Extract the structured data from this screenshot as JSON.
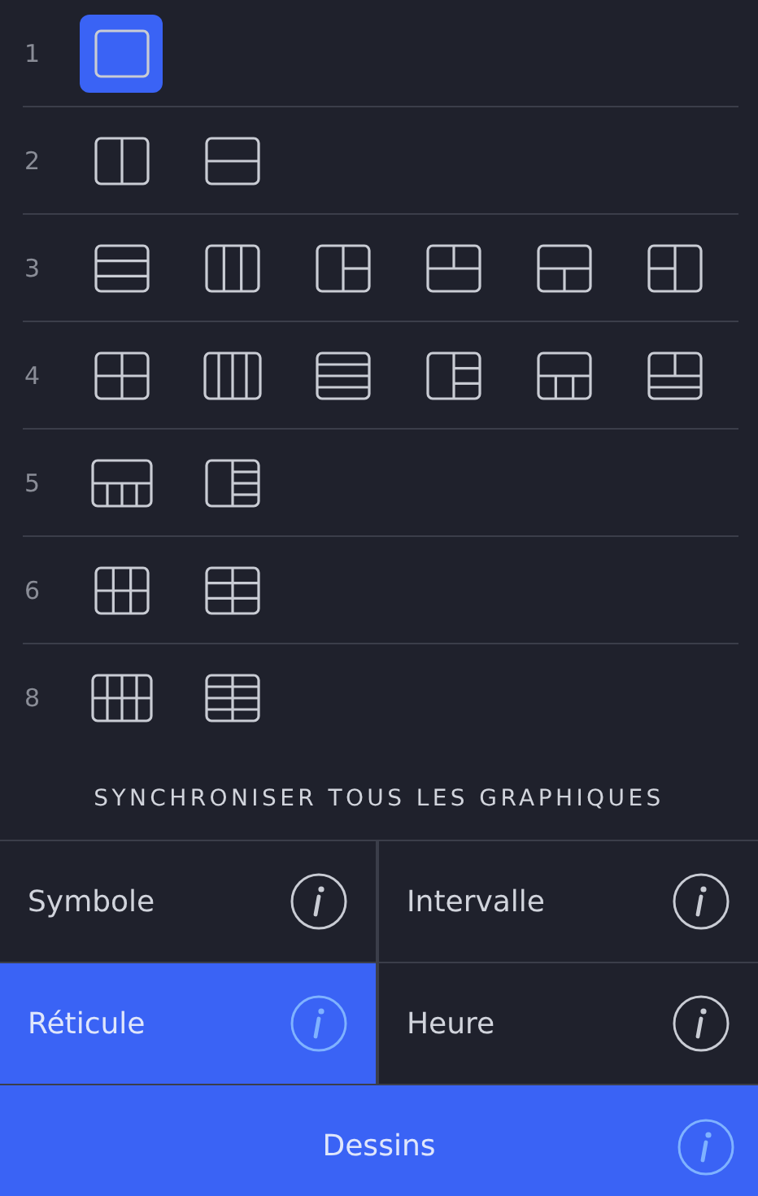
{
  "layout_rows": [
    {
      "count": "1",
      "layouts": [
        {
          "kind": "single",
          "selected": true
        }
      ]
    },
    {
      "count": "2",
      "layouts": [
        {
          "kind": "cols-2",
          "selected": false
        },
        {
          "kind": "rows-2",
          "selected": false
        }
      ]
    },
    {
      "count": "3",
      "layouts": [
        {
          "kind": "rows-3",
          "selected": false
        },
        {
          "kind": "cols-3",
          "selected": false
        },
        {
          "kind": "left-1-right-2",
          "selected": false
        },
        {
          "kind": "top-2-bottom-1",
          "selected": false
        },
        {
          "kind": "top-1-bottom-2",
          "selected": false
        },
        {
          "kind": "left-2-right-1",
          "selected": false
        }
      ]
    },
    {
      "count": "4",
      "layouts": [
        {
          "kind": "grid-2x2",
          "selected": false
        },
        {
          "kind": "cols-4",
          "selected": false
        },
        {
          "kind": "rows-4",
          "selected": false
        },
        {
          "kind": "left-1-right-3",
          "selected": false
        },
        {
          "kind": "top-1-bottom-3",
          "selected": false
        },
        {
          "kind": "top-2-bottom-rows-2",
          "selected": false
        }
      ]
    },
    {
      "count": "5",
      "layouts": [
        {
          "kind": "top-1-bottom-4",
          "selected": false
        },
        {
          "kind": "left-1-right-4",
          "selected": false
        }
      ]
    },
    {
      "count": "6",
      "layouts": [
        {
          "kind": "grid-3x2",
          "selected": false
        },
        {
          "kind": "grid-2x3",
          "selected": false
        }
      ]
    },
    {
      "count": "8",
      "layouts": [
        {
          "kind": "grid-4x2",
          "selected": false
        },
        {
          "kind": "grid-2x4",
          "selected": false
        }
      ]
    }
  ],
  "sync": {
    "title": "SYNCHRONISER TOUS LES GRAPHIQUES",
    "options": [
      {
        "label": "Symbole",
        "selected": false
      },
      {
        "label": "Intervalle",
        "selected": false
      },
      {
        "label": "Réticule",
        "selected": true
      },
      {
        "label": "Heure",
        "selected": false
      },
      {
        "label": "Dessins",
        "selected": true
      }
    ]
  }
}
